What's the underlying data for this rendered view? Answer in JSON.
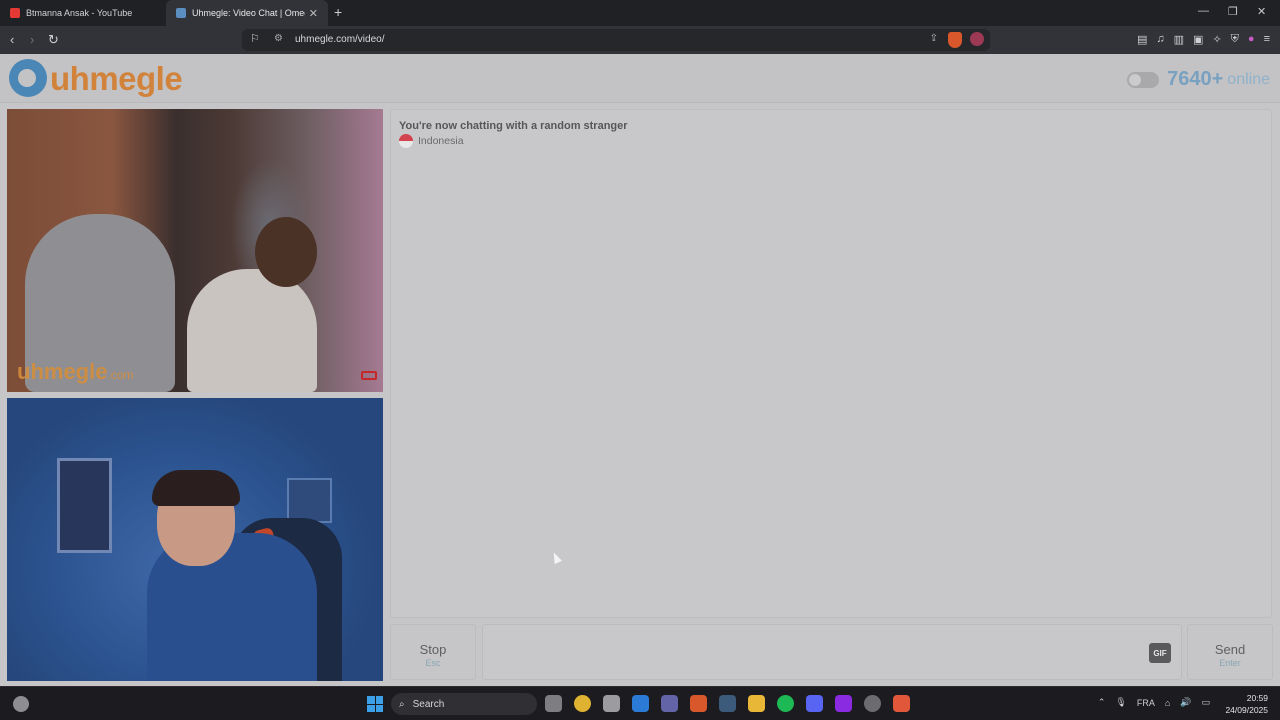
{
  "browser": {
    "tabs": [
      {
        "title": "Btmanna Ansak - YouTube",
        "favicon": "youtube-icon",
        "color": "#e53935"
      },
      {
        "title": "Uhmegle: Video Chat | Omeg",
        "favicon": "uhmegle-icon",
        "color": "#5b8ec1"
      }
    ],
    "address": "uhmegle.com/video/"
  },
  "site": {
    "logo_text": "uhmegle",
    "online_count": "7640+",
    "online_label": "online"
  },
  "stranger_video": {
    "watermark": "uhmegle",
    "watermark_suffix": ".com"
  },
  "chat": {
    "status": "You're now chatting with a random stranger",
    "country": "Indonesia"
  },
  "controls": {
    "stop_label": "Stop",
    "stop_hint": "Esc",
    "gif_label": "GIF",
    "send_label": "Send",
    "send_hint": "Enter"
  },
  "taskbar": {
    "search_label": "Search",
    "language": "FRA",
    "time": "20:59",
    "date": "24/09/2025"
  }
}
